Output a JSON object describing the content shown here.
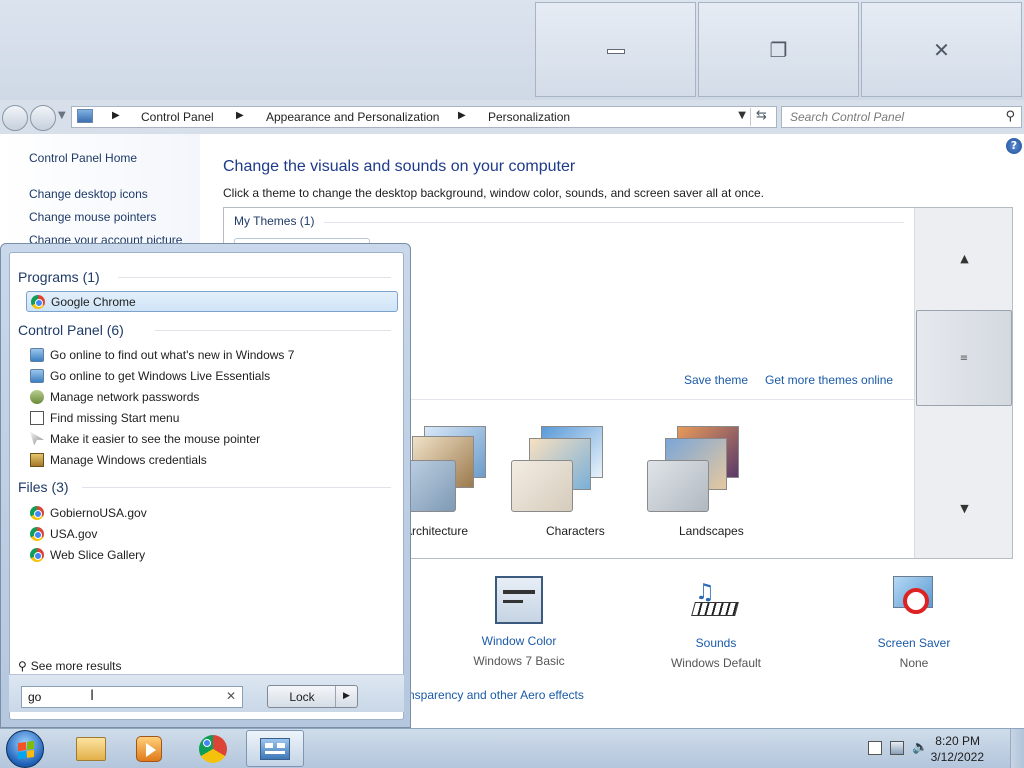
{
  "window": {
    "min_icon": "minimize-icon",
    "max_icon": "restore-icon",
    "close_icon": "close-icon",
    "close_glyph": "✕",
    "restore_glyph": "❐"
  },
  "address": {
    "crumbs": [
      "Control Panel",
      "Appearance and Personalization",
      "Personalization"
    ],
    "search_placeholder": "Search Control Panel"
  },
  "left_pane": {
    "links": [
      "Control Panel Home",
      "Change desktop icons",
      "Change mouse pointers",
      "Change your account picture"
    ]
  },
  "main": {
    "title": "Change the visuals and sounds on your computer",
    "description": "Click a theme to change the desktop background, window color, sounds, and screen saver all at once.",
    "my_themes_label": "My Themes (1)",
    "save_theme": "Save theme",
    "get_more_themes": "Get more themes online",
    "themes": [
      "Architecture",
      "Characters",
      "Landscapes"
    ],
    "bottom": [
      {
        "title": "Window Color",
        "sub": "Windows 7 Basic"
      },
      {
        "title": "Sounds",
        "sub": "Windows Default"
      },
      {
        "title": "Screen Saver",
        "sub": "None"
      }
    ],
    "aero_link": "nsparency and other Aero effects"
  },
  "start_menu": {
    "programs_header": "Programs (1)",
    "programs": [
      "Google Chrome"
    ],
    "control_panel_header": "Control Panel (6)",
    "control_panel": [
      "Go online to find out what's new in Windows 7",
      "Go online to get Windows Live Essentials",
      "Manage network passwords",
      "Find missing Start menu",
      "Make it easier to see the mouse pointer",
      "Manage Windows credentials"
    ],
    "files_header": "Files (3)",
    "files": [
      "GobiernoUSA.gov",
      "USA.gov",
      "Web Slice Gallery"
    ],
    "see_more": "See more results",
    "search_value": "go",
    "lock_label": "Lock"
  },
  "taskbar": {
    "pinned": [
      "explorer-icon",
      "media-player-icon",
      "chrome-icon",
      "control-panel-icon"
    ],
    "time": "8:20 PM",
    "date": "3/12/2022"
  }
}
